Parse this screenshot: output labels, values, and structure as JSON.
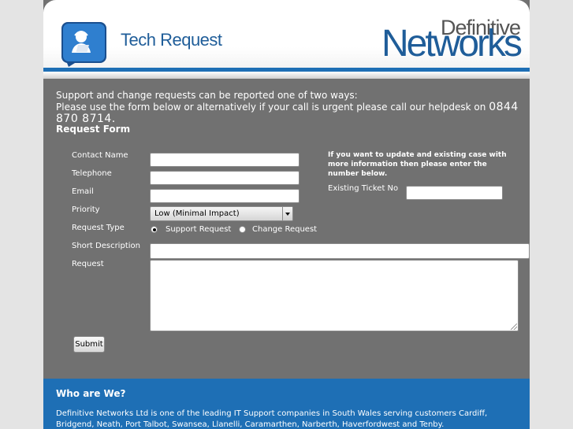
{
  "header": {
    "title": "Tech Request",
    "brand_top": "Definitive",
    "brand_main": "Networks"
  },
  "intro": {
    "line1": "Support and change requests can be reported one of two ways:",
    "line2": "Please use the form below or alternatively if your call is urgent please call our helpdesk on",
    "phone": "0844 870 8714."
  },
  "form": {
    "title": "Request Form",
    "contact_label": "Contact Name",
    "telephone_label": "Telephone",
    "email_label": "Email",
    "priority_label": "Priority",
    "priority_value": "Low (Minimal Impact)",
    "request_type_label": "Request Type",
    "type_option_support": "Support Request",
    "type_option_change": "Change Request",
    "short_desc_label": "Short Description",
    "request_label": "Request",
    "submit_label": "Submit"
  },
  "existing": {
    "note": "If you want to update and existing case with more information then please enter the number below.",
    "ticket_label": "Existing Ticket No"
  },
  "footer": {
    "title": "Who are We?",
    "text": "Definitive Networks Ltd is one of the leading IT Support companies in South Wales serving customers Cardiff, Bridgend, Neath, Port Talbot, Swansea, Llanelli, Caramarthen, Narberth, Haverfordwest and Tenby."
  },
  "colors": {
    "brand_blue": "#1e6fb5",
    "panel_gray": "#717171"
  }
}
